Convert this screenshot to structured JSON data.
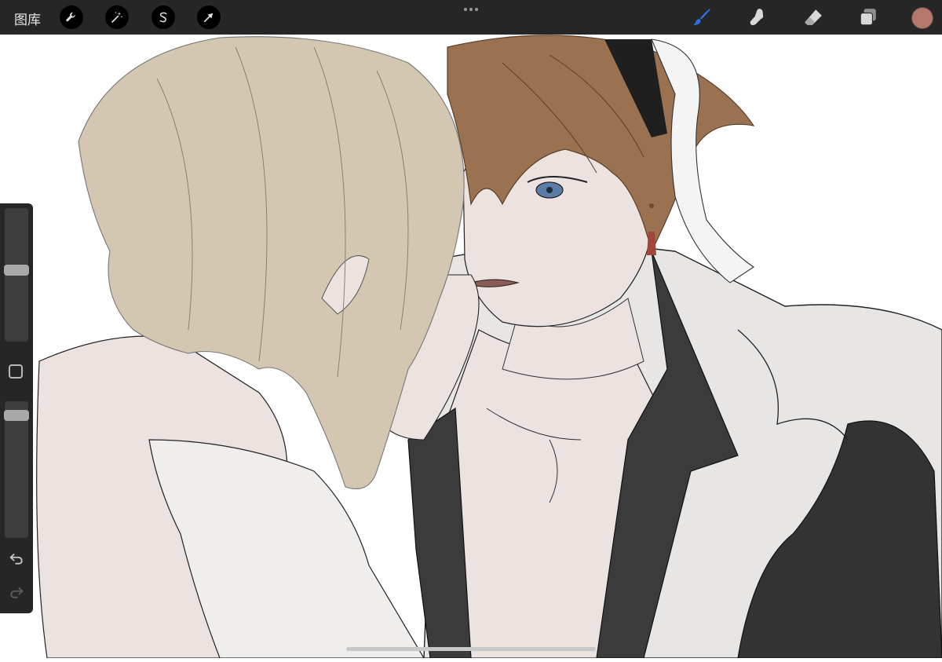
{
  "toolbar": {
    "gallery_label": "图库",
    "left_tools": [
      {
        "name": "actions",
        "icon": "wrench-icon"
      },
      {
        "name": "adjustments",
        "icon": "magic-wand-icon"
      },
      {
        "name": "selection",
        "icon": "selection-s-icon"
      },
      {
        "name": "transform",
        "icon": "arrow-cursor-icon"
      }
    ],
    "more_icon": "ellipsis-icon",
    "right_tools": [
      {
        "name": "brush",
        "icon": "brush-icon",
        "active": true
      },
      {
        "name": "smudge",
        "icon": "smudge-icon"
      },
      {
        "name": "eraser",
        "icon": "eraser-icon"
      },
      {
        "name": "layers",
        "icon": "layers-icon"
      }
    ],
    "current_color": "#b3786a",
    "active_color": "#2f6fe0"
  },
  "sidebar": {
    "brush_size_level": 0.54,
    "brush_opacity_level": 0.93,
    "modify_icon": "square-modify-icon",
    "undo_icon": "undo-icon",
    "redo_icon": "redo-icon"
  }
}
